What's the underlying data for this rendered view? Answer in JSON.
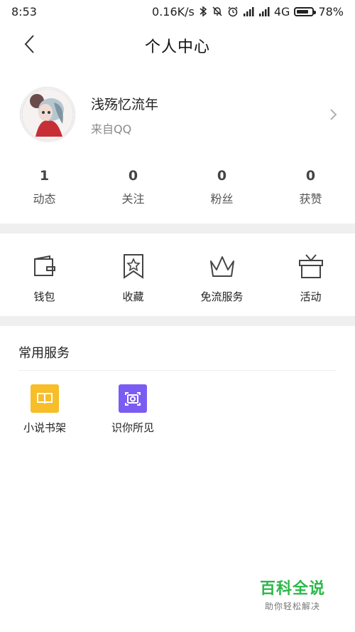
{
  "status_bar": {
    "time": "8:53",
    "network_speed": "0.16K/s",
    "network_type": "4G",
    "battery_percent": "78%",
    "battery_level": 0.78,
    "icons": [
      "bluetooth-icon",
      "mute-icon",
      "alarm-icon",
      "signal-icon",
      "signal-icon",
      "battery-icon"
    ]
  },
  "header": {
    "title": "个人中心"
  },
  "profile": {
    "name": "浅殇忆流年",
    "source": "来自QQ"
  },
  "stats": [
    {
      "value": "1",
      "label": "动态"
    },
    {
      "value": "0",
      "label": "关注"
    },
    {
      "value": "0",
      "label": "粉丝"
    },
    {
      "value": "0",
      "label": "获赞"
    }
  ],
  "menu": [
    {
      "label": "钱包",
      "icon": "wallet-icon"
    },
    {
      "label": "收藏",
      "icon": "bookmark-star-icon"
    },
    {
      "label": "免流服务",
      "icon": "crown-icon"
    },
    {
      "label": "活动",
      "icon": "gift-box-icon"
    }
  ],
  "services": {
    "title": "常用服务",
    "items": [
      {
        "label": "小说书架",
        "icon": "book-icon",
        "color": "#f7be2a"
      },
      {
        "label": "识你所见",
        "icon": "camera-scan-icon",
        "color": "#7b5cf2"
      }
    ]
  },
  "watermark": {
    "title": "百科全说",
    "subtitle": "助你轻松解决"
  }
}
